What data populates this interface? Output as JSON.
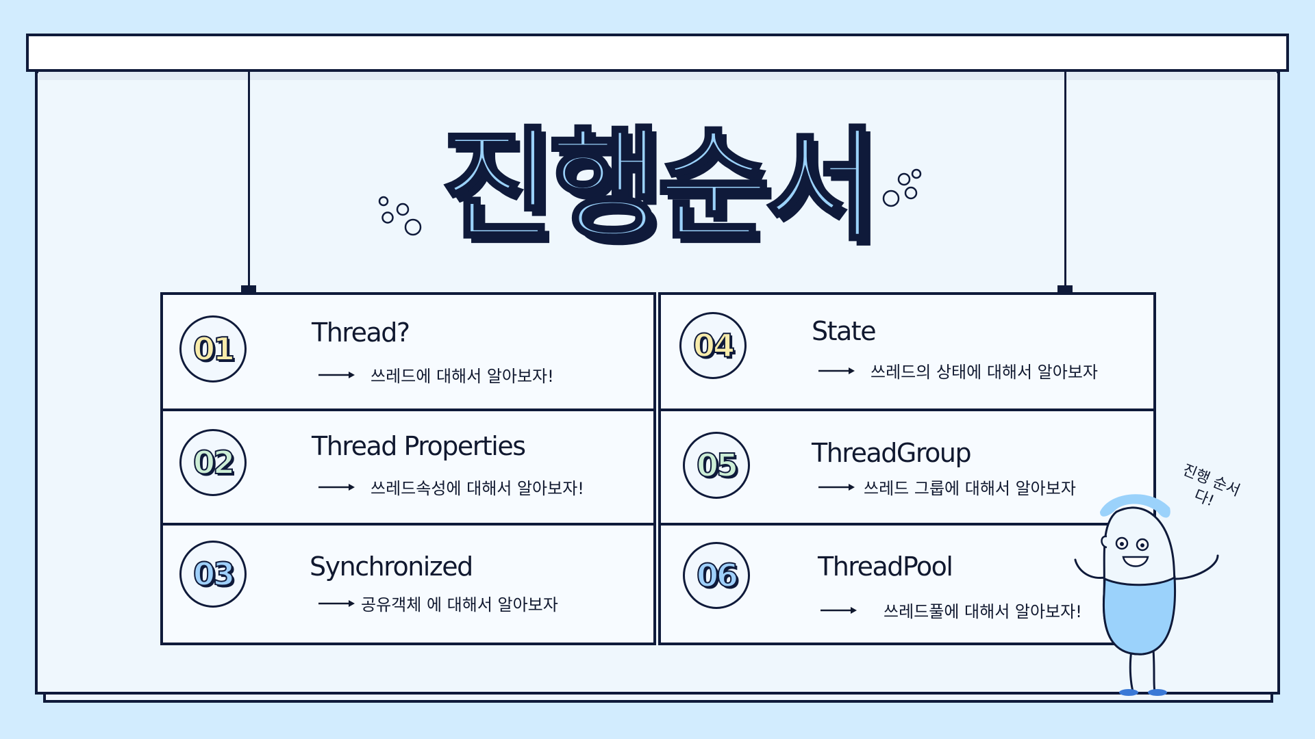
{
  "title": "진행순서",
  "items": [
    {
      "number": "01",
      "title": "Thread?",
      "desc": "쓰레드에 대해서 알아보자!"
    },
    {
      "number": "02",
      "title": "Thread Properties",
      "desc": "쓰레드속성에 대해서 알아보자!"
    },
    {
      "number": "03",
      "title": "Synchronized",
      "desc": "공유객체 에 대해서 알아보자"
    },
    {
      "number": "04",
      "title": "State",
      "desc": "쓰레드의 상태에 대해서 알아보자"
    },
    {
      "number": "05",
      "title": "ThreadGroup",
      "desc": "쓰레드 그룹에 대해서 알아보자"
    },
    {
      "number": "06",
      "title": "ThreadPool",
      "desc": "쓰레드풀에 대해서 알아보자!"
    }
  ],
  "speech": "진행 순서다!",
  "colors": {
    "background": "#d2ecfe",
    "board": "#eff7fd",
    "outline": "#0f1a3a",
    "title_fill": "#9bd2fb",
    "badge_yellow": "#f8ecab",
    "badge_green": "#cdeed6",
    "badge_blue": "#9fd0fa",
    "character": "#9bd2fb"
  },
  "icons": [
    "arrow-right-icon",
    "bubbles-decoration",
    "character-illustration"
  ]
}
